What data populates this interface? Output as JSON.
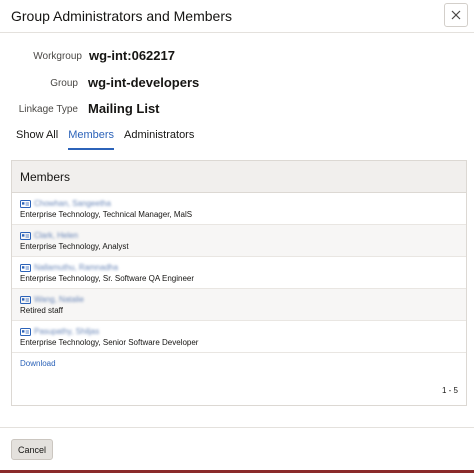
{
  "dialog": {
    "title": "Group Administrators and Members",
    "close_label": "Close"
  },
  "fields": {
    "workgroup_label": "Workgroup",
    "workgroup_value": "wg-int:062217",
    "group_label": "Group",
    "group_value": "wg-int-developers",
    "linkage_label": "Linkage Type",
    "linkage_value": "Mailing List"
  },
  "tabs": [
    {
      "label": "Show All",
      "active": false
    },
    {
      "label": "Members",
      "active": true
    },
    {
      "label": "Administrators",
      "active": false
    }
  ],
  "members_panel": {
    "heading": "Members",
    "rows": [
      {
        "name": "Chowhan, Sangeetha",
        "title": "Enterprise Technology, Technical Manager, MalS"
      },
      {
        "name": "Clark, Helen",
        "title": "Enterprise Technology, Analyst"
      },
      {
        "name": "Nallamuthu, Ramnadha",
        "title": "Enterprise Technology, Sr. Software QA Engineer"
      },
      {
        "name": "Wang, Natalie",
        "title": "Retired staff"
      },
      {
        "name": "Pasupathy, Shiljas",
        "title": "Enterprise Technology, Senior Software Developer"
      }
    ],
    "download_label": "Download",
    "pager": "1 - 5"
  },
  "footer": {
    "cancel_label": "Cancel"
  },
  "colors": {
    "accent": "#2c63b9",
    "panel_header_bg": "#f1efed",
    "bottom_bar": "#8a2a2a"
  }
}
